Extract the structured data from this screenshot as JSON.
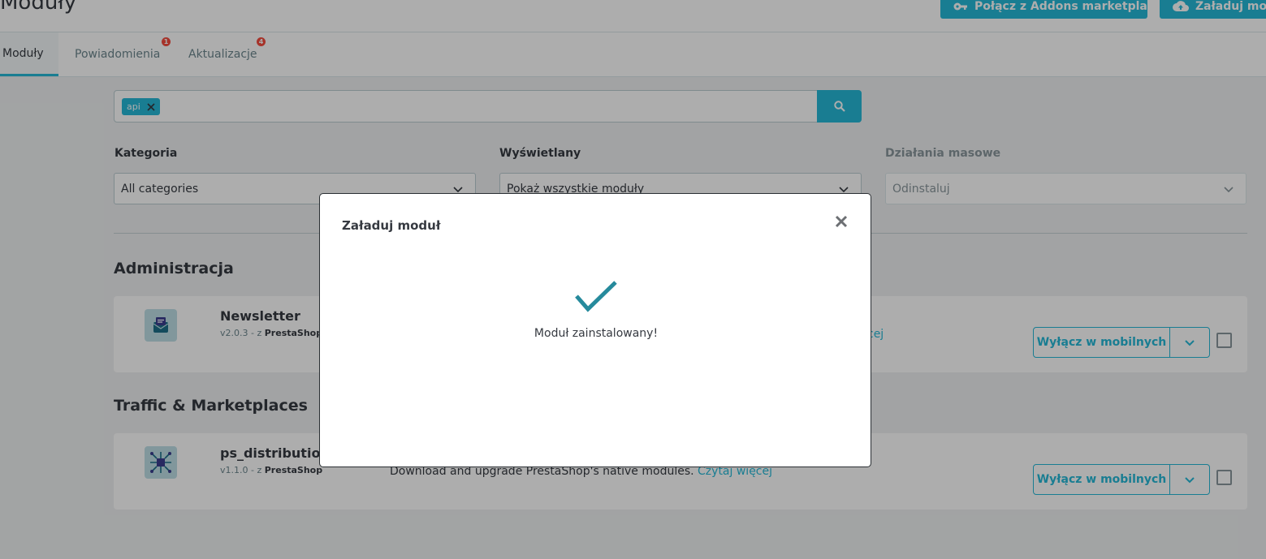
{
  "header": {
    "title": "Moduły",
    "buttons": [
      {
        "label": "Połącz z Addons marketplace",
        "icon": "key-icon"
      },
      {
        "label": "Załaduj moduł",
        "icon": "cloud-upload-icon"
      }
    ]
  },
  "tabs": [
    {
      "label": "Moduły",
      "active": true
    },
    {
      "label": "Powiadomienia",
      "badge": "1"
    },
    {
      "label": "Aktualizacje",
      "badge": "4"
    }
  ],
  "search": {
    "chip": "api",
    "button_icon": "search-icon"
  },
  "filters": {
    "category": {
      "label": "Kategoria",
      "value": "All categories"
    },
    "display": {
      "label": "Wyświetlany",
      "value": "Pokaż wszystkie moduły"
    },
    "bulk": {
      "label": "Działania masowe",
      "value": "Odinstaluj"
    }
  },
  "sections": [
    {
      "title": "Administracja",
      "module": {
        "name": "Newsletter",
        "version": "v2.0.3 - z",
        "author": "PrestaShop",
        "description": "",
        "more": "cej",
        "action": "Wyłącz w mobilnych"
      }
    },
    {
      "title": "Traffic & Marketplaces",
      "module": {
        "name": "ps_distributiona",
        "version": "v1.1.0 - z",
        "author": "PrestaShop",
        "description": "Download and upgrade PrestaShop's native modules.",
        "more": "Czytaj więcej",
        "action": "Wyłącz w mobilnych"
      }
    }
  ],
  "modal": {
    "title": "Załaduj moduł",
    "message": "Moduł zainstalowany!"
  },
  "colors": {
    "accent": "#25b9d7",
    "success_check": "#268a9c",
    "badge": "#f54c3e"
  }
}
